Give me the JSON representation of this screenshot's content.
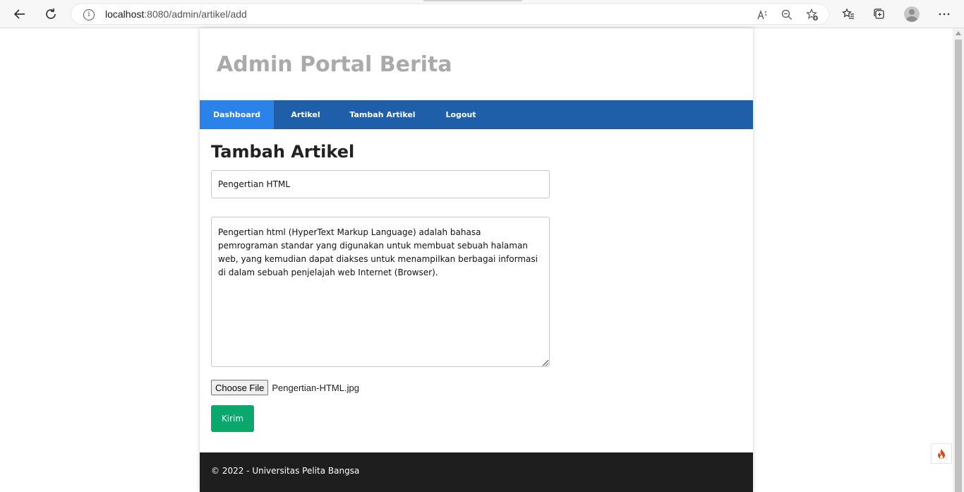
{
  "browser": {
    "url_host": "localhost",
    "url_path": ":8080/admin/artikel/add",
    "back_icon": "back-arrow-icon",
    "reload_icon": "reload-icon",
    "info_icon": "site-info-icon",
    "read_aloud_icon": "read-aloud-icon",
    "zoom_icon": "zoom-out-icon",
    "add_favorite_icon": "add-favorite-icon",
    "favorites_icon": "favorites-icon",
    "collections_icon": "collections-icon",
    "profile_icon": "profile-avatar-icon",
    "more_icon": "more-menu-icon"
  },
  "site": {
    "title": "Admin Portal Berita",
    "nav": [
      {
        "label": "Dashboard",
        "active": true
      },
      {
        "label": "Artikel",
        "active": false
      },
      {
        "label": "Tambah Artikel",
        "active": false
      },
      {
        "label": "Logout",
        "active": false
      }
    ]
  },
  "form": {
    "heading": "Tambah Artikel",
    "title_value": "Pengertian HTML",
    "body_value": "Pengertian html (HyperText Markup Language) adalah bahasa pemrograman standar yang digunakan untuk membuat sebuah halaman web, yang kemudian dapat diakses untuk menampilkan berbagai informasi di dalam sebuah penjelajah web Internet (Browser).",
    "choose_file_label": "Choose File",
    "file_name": "Pengertian-HTML.jpg",
    "submit_label": "Kirim"
  },
  "footer": {
    "text": "© 2022 - Universitas Pelita Bangsa"
  },
  "colors": {
    "nav_bg": "#1f5faa",
    "nav_active": "#2b83ea",
    "submit_bg": "#0aa86a",
    "footer_bg": "#1e1e1e",
    "title_color": "#aaaaaa"
  },
  "debug_toolbar_icon": "codeigniter-flame-icon"
}
